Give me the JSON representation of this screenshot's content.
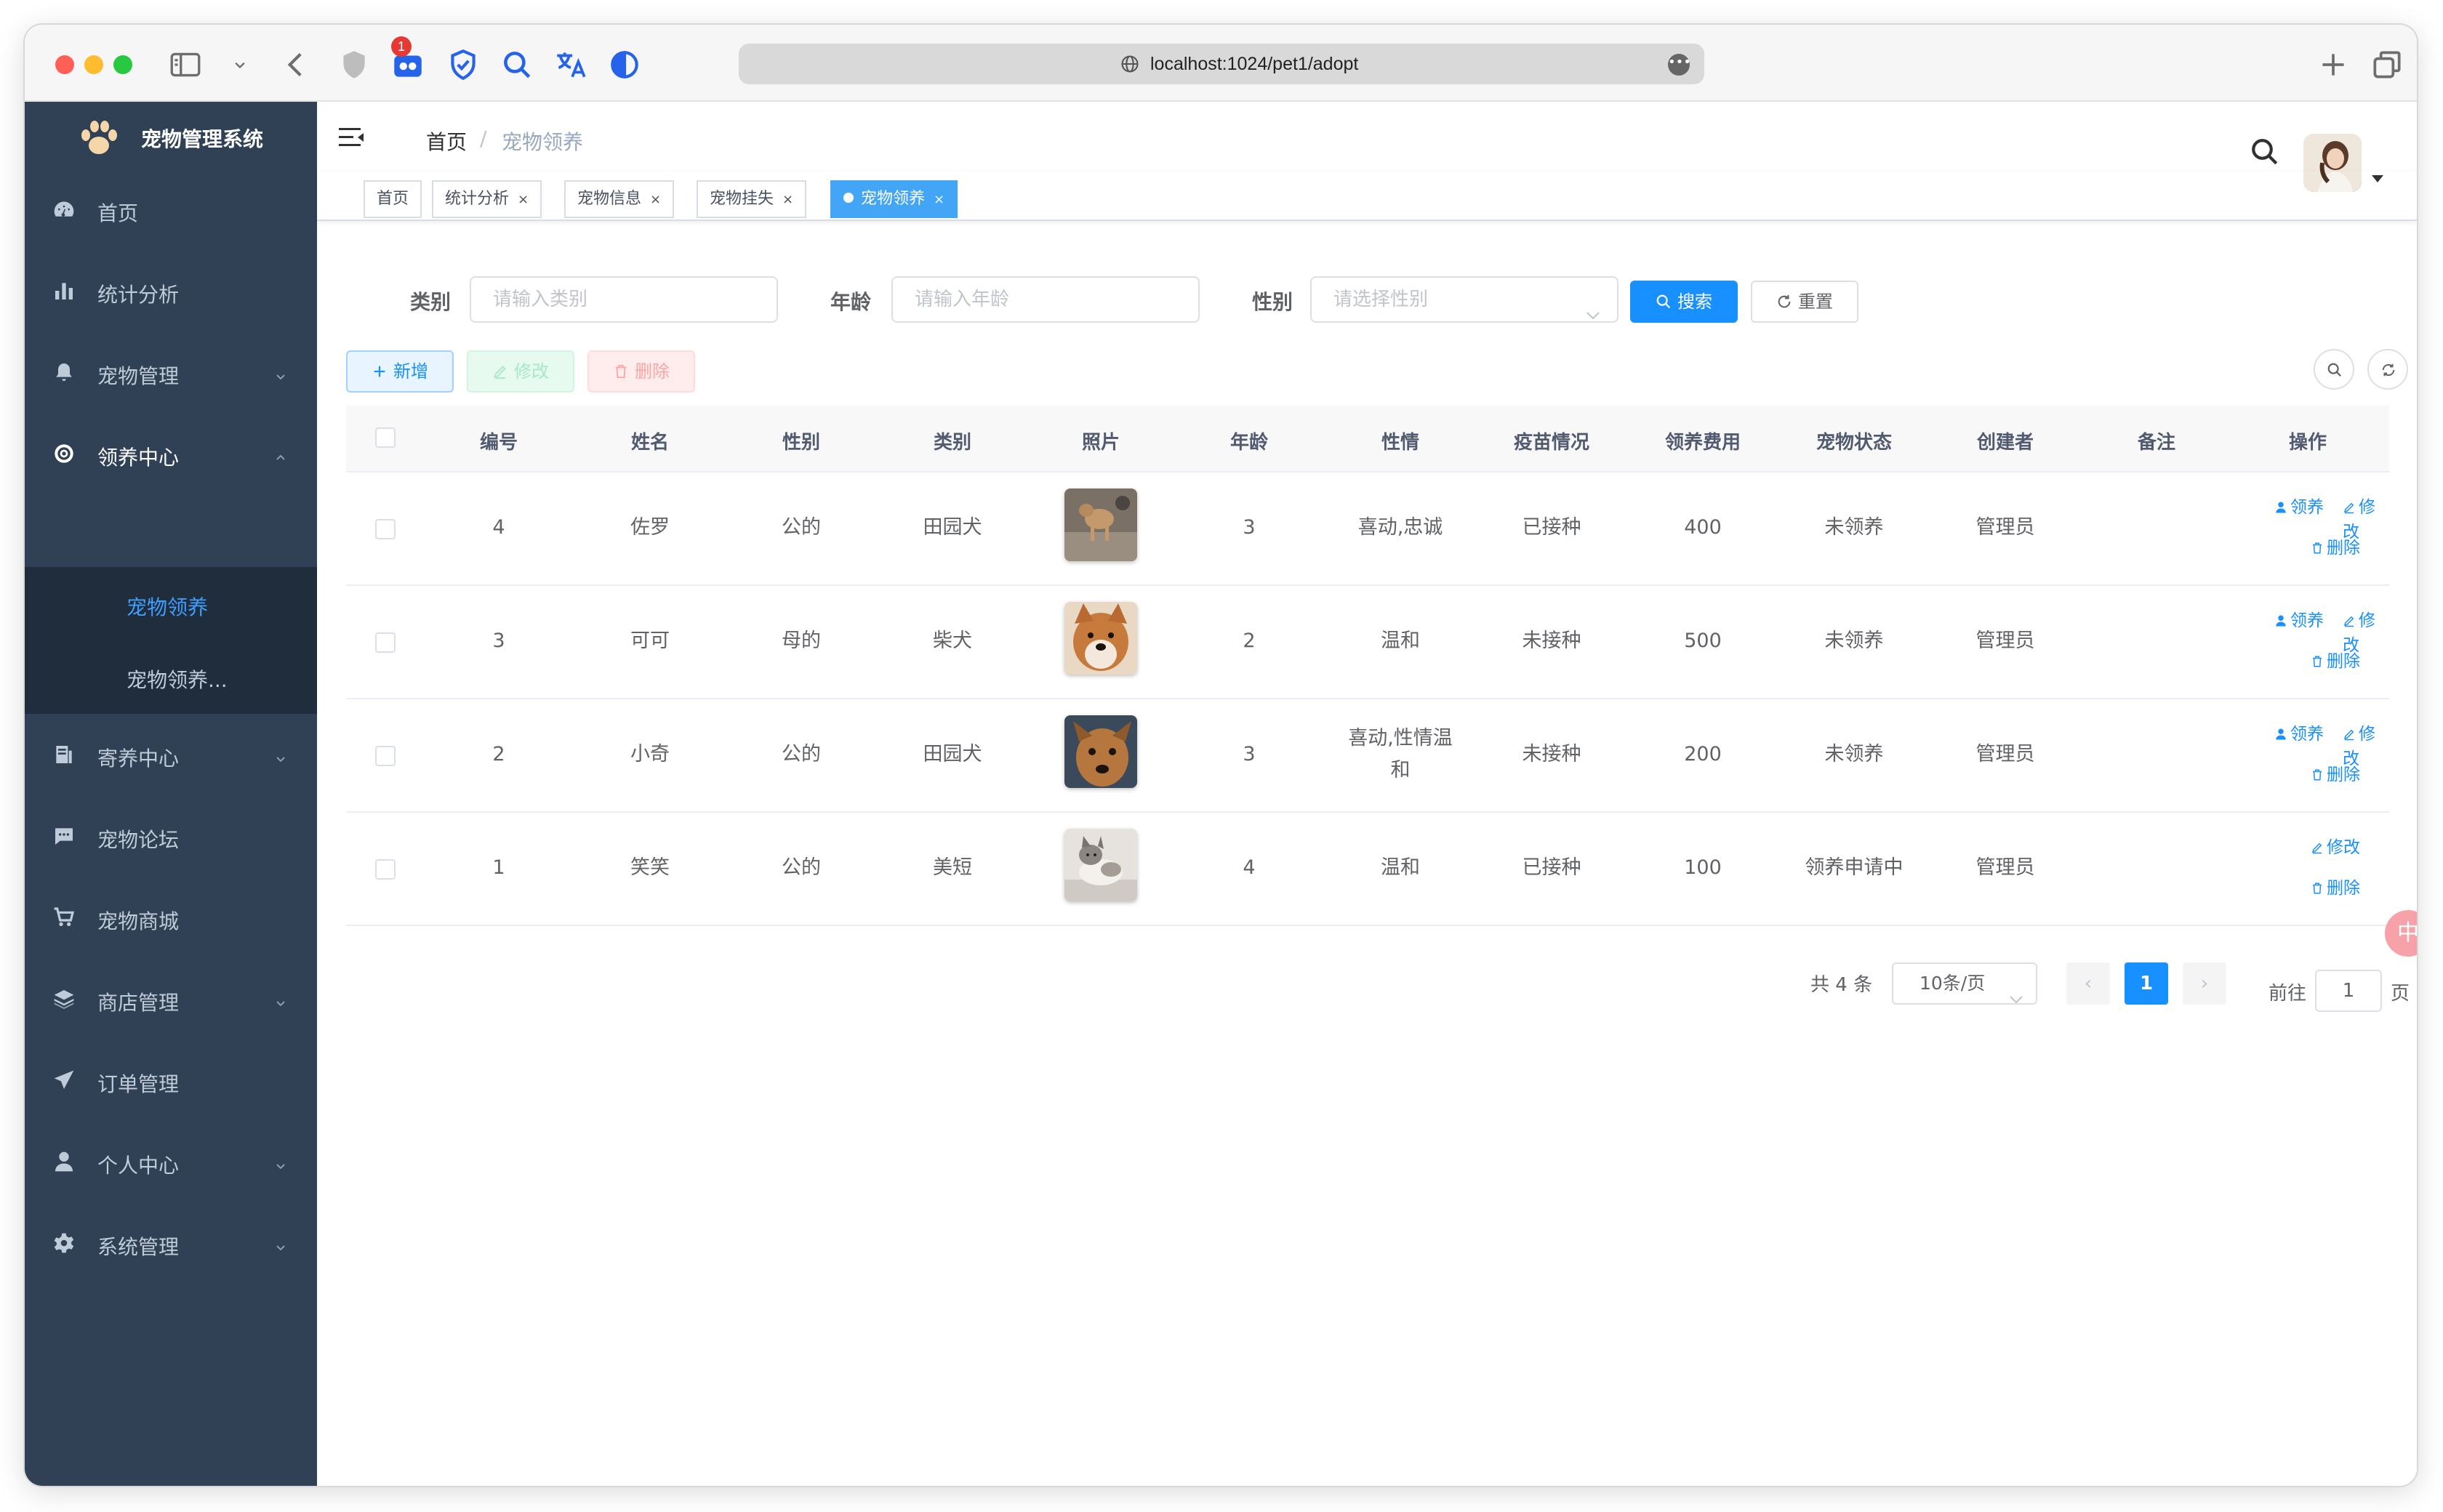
{
  "browser": {
    "url": "localhost:1024/pet1/adopt",
    "extension_badge": "1",
    "icons": [
      "sidebar-toggle-icon",
      "chevron-down-icon",
      "back-icon",
      "shield-icon",
      "extension-icon",
      "checkmark-shield-icon",
      "magnify-icon",
      "translate-icon",
      "dark-mode-icon",
      "plus-icon",
      "tabs-icon"
    ]
  },
  "app": {
    "title": "宠物管理系统"
  },
  "sidebar": {
    "items": [
      {
        "label": "首页",
        "icon": "dashboard-icon"
      },
      {
        "label": "统计分析",
        "icon": "bar-chart-icon"
      },
      {
        "label": "宠物管理",
        "icon": "bell-icon"
      },
      {
        "label": "领养中心",
        "icon": "lifebuoy-icon"
      },
      {
        "label": "寄养中心",
        "icon": "document-icon"
      },
      {
        "label": "宠物论坛",
        "icon": "chat-icon"
      },
      {
        "label": "宠物商城",
        "icon": "cart-icon"
      },
      {
        "label": "商店管理",
        "icon": "layers-icon"
      },
      {
        "label": "订单管理",
        "icon": "send-icon"
      },
      {
        "label": "个人中心",
        "icon": "user-icon"
      },
      {
        "label": "系统管理",
        "icon": "gear-icon"
      }
    ],
    "sub_items": [
      {
        "label": "宠物领养"
      },
      {
        "label": "宠物领养..."
      }
    ]
  },
  "breadcrumb": {
    "home": "首页",
    "separator": "/",
    "current": "宠物领养"
  },
  "tags": [
    {
      "label": "首页"
    },
    {
      "label": "统计分析",
      "close": "×"
    },
    {
      "label": "宠物信息",
      "close": "×"
    },
    {
      "label": "宠物挂失",
      "close": "×"
    },
    {
      "label": "宠物领养",
      "close": "×"
    }
  ],
  "search_form": {
    "category_label": "类别",
    "category_placeholder": "请输入类别",
    "age_label": "年龄",
    "age_placeholder": "请输入年龄",
    "gender_label": "性别",
    "gender_placeholder": "请选择性别",
    "search_button": "搜索",
    "reset_button": "重置"
  },
  "toolbar": {
    "add": "新增",
    "edit": "修改",
    "delete": "删除"
  },
  "table": {
    "headers": [
      "编号",
      "姓名",
      "性别",
      "类别",
      "照片",
      "年龄",
      "性情",
      "疫苗情况",
      "领养费用",
      "宠物状态",
      "创建者",
      "备注",
      "操作"
    ],
    "rows": [
      {
        "id": "4",
        "name": "佐罗",
        "gender": "公的",
        "category": "田园犬",
        "age": "3",
        "temper": "喜动,忠诚",
        "vaccine": "已接种",
        "fee": "400",
        "status": "未领养",
        "creator": "管理员",
        "remark": "",
        "ops": {
          "adopt": "领养",
          "edit": "修改",
          "delete": "删除"
        }
      },
      {
        "id": "3",
        "name": "可可",
        "gender": "母的",
        "category": "柴犬",
        "age": "2",
        "temper": "温和",
        "vaccine": "未接种",
        "fee": "500",
        "status": "未领养",
        "creator": "管理员",
        "remark": "",
        "ops": {
          "adopt": "领养",
          "edit": "修改",
          "delete": "删除"
        }
      },
      {
        "id": "2",
        "name": "小奇",
        "gender": "公的",
        "category": "田园犬",
        "age": "3",
        "temper_line1": "喜动,性情温",
        "temper_line2": "和",
        "vaccine": "未接种",
        "fee": "200",
        "status": "未领养",
        "creator": "管理员",
        "remark": "",
        "ops": {
          "adopt": "领养",
          "edit": "修改",
          "delete": "删除"
        }
      },
      {
        "id": "1",
        "name": "笑笑",
        "gender": "公的",
        "category": "美短",
        "age": "4",
        "temper": "温和",
        "vaccine": "已接种",
        "fee": "100",
        "status": "领养申请中",
        "creator": "管理员",
        "remark": "",
        "ops": {
          "edit": "修改",
          "delete": "删除"
        }
      }
    ]
  },
  "pagination": {
    "total": "共 4 条",
    "page_size": "10条/页",
    "prev": "‹",
    "current_page": "1",
    "next": "›",
    "goto_label": "前往",
    "goto_value": "1",
    "goto_suffix": "页"
  },
  "float_badge": "中",
  "colors": {
    "sidebar_bg": "#304156",
    "submenu_bg": "#1f2d3d",
    "accent": "#1890ff",
    "tag_active": "#42a5f5"
  }
}
